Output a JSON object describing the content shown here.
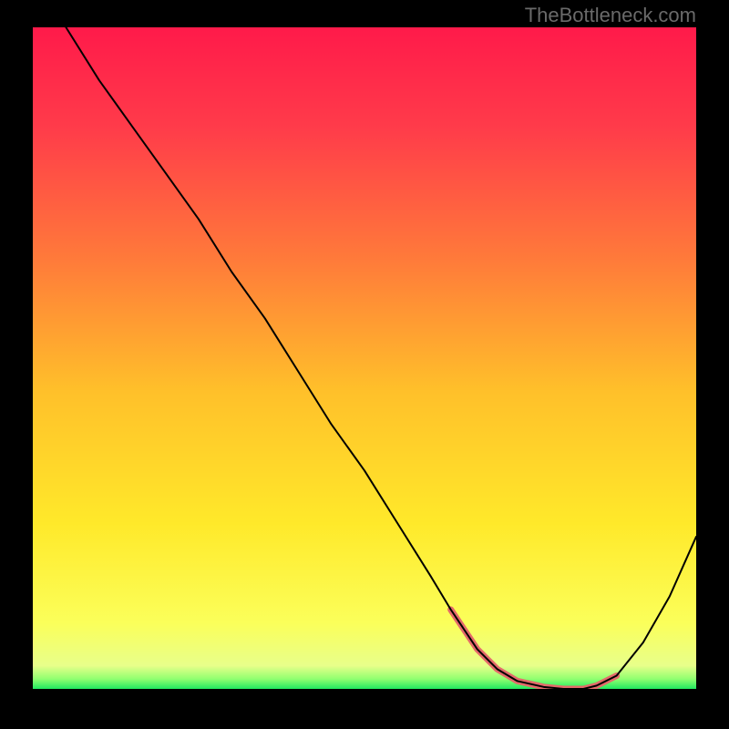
{
  "watermark": "TheBottleneck.com",
  "chart_data": {
    "type": "line",
    "title": "",
    "xlabel": "",
    "ylabel": "",
    "xlim": [
      0,
      100
    ],
    "ylim": [
      0,
      100
    ],
    "background_gradient": {
      "stops": [
        {
          "offset": 0.0,
          "color": "#ff1a4a"
        },
        {
          "offset": 0.15,
          "color": "#ff3b4a"
        },
        {
          "offset": 0.35,
          "color": "#ff7a3a"
        },
        {
          "offset": 0.55,
          "color": "#ffc02a"
        },
        {
          "offset": 0.75,
          "color": "#ffe92a"
        },
        {
          "offset": 0.9,
          "color": "#fbff5a"
        },
        {
          "offset": 0.965,
          "color": "#e8ff8a"
        },
        {
          "offset": 0.985,
          "color": "#90ff70"
        },
        {
          "offset": 1.0,
          "color": "#20e860"
        }
      ]
    },
    "series": [
      {
        "name": "bottleneck-curve",
        "color": "#000000",
        "width": 2,
        "x": [
          5,
          10,
          15,
          20,
          25,
          30,
          35,
          40,
          45,
          50,
          55,
          60,
          63,
          67,
          70,
          73,
          77,
          80,
          83,
          85,
          88,
          92,
          96,
          100
        ],
        "y": [
          100,
          92,
          85,
          78,
          71,
          63,
          56,
          48,
          40,
          33,
          25,
          17,
          12,
          6,
          3,
          1.2,
          0.3,
          0,
          0,
          0.5,
          2,
          7,
          14,
          23
        ]
      }
    ],
    "highlight_segment": {
      "name": "min-region",
      "color": "#e46a6a",
      "width": 7,
      "x": [
        63,
        67,
        70,
        73,
        77,
        80,
        83,
        85,
        88
      ],
      "y": [
        12,
        6,
        3,
        1.2,
        0.3,
        0,
        0,
        0.5,
        2
      ]
    }
  }
}
